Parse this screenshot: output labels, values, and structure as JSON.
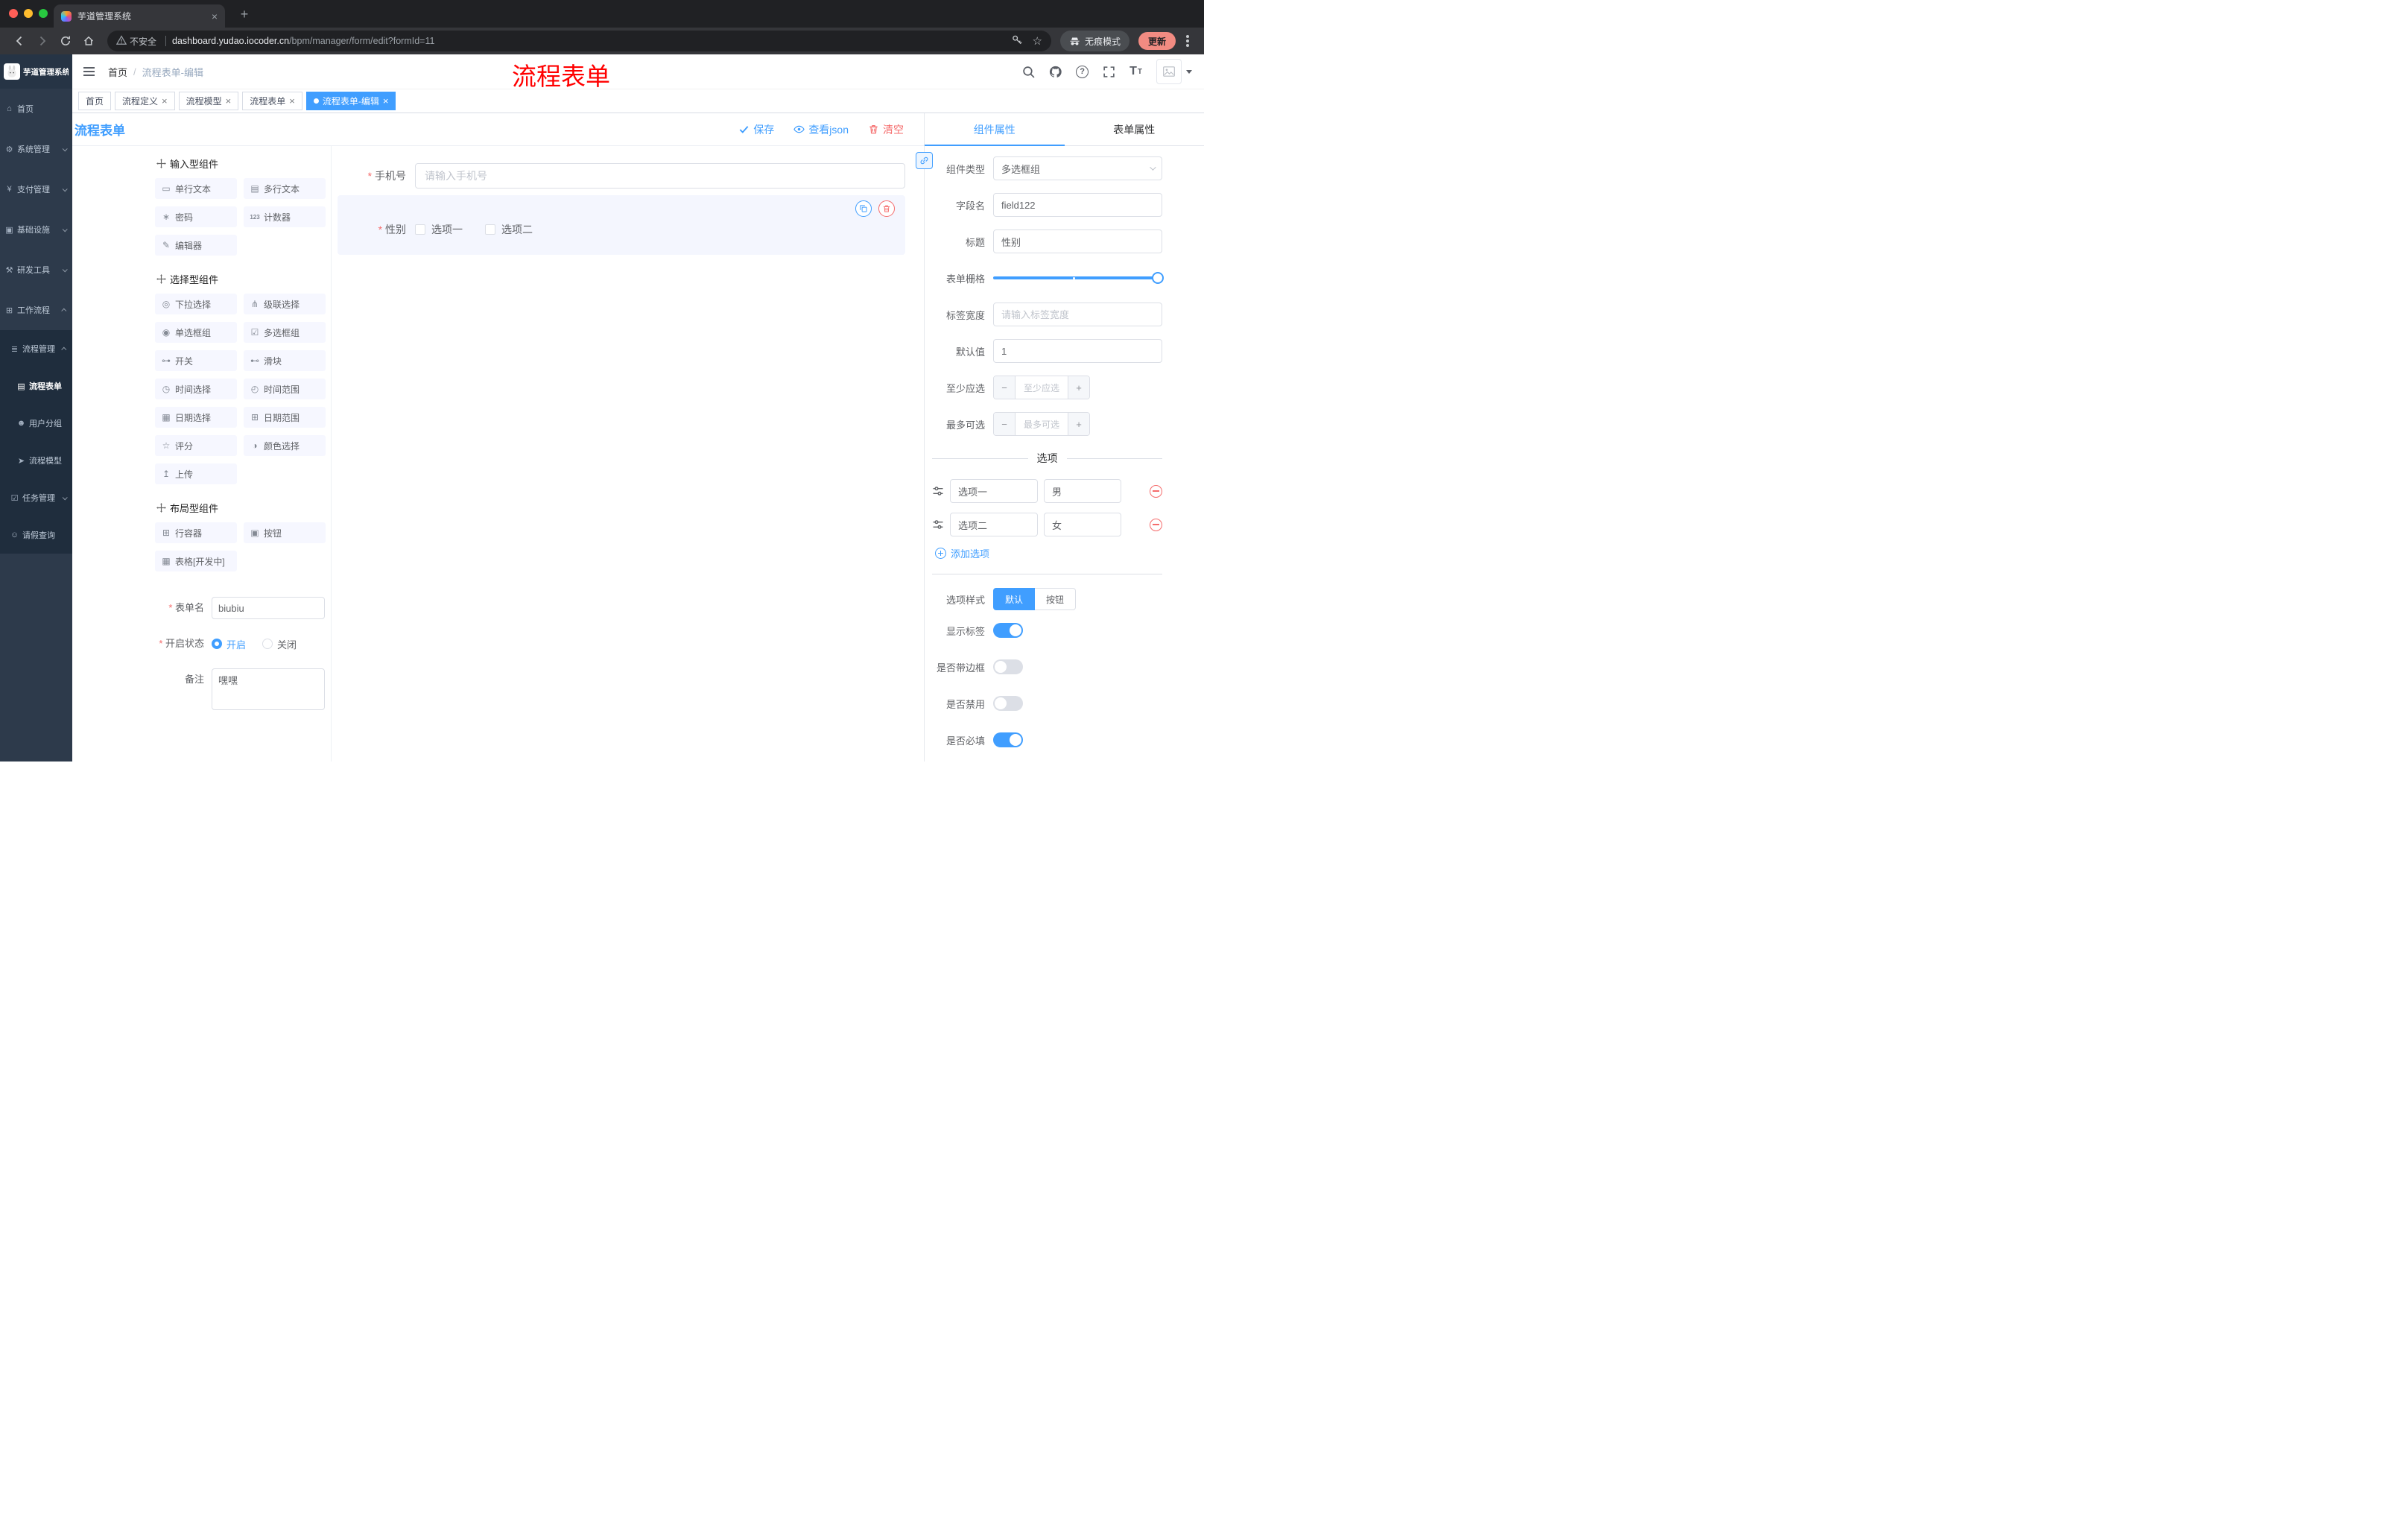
{
  "browser": {
    "tab": {
      "title": "芋道管理系统"
    },
    "address": {
      "security": "不安全",
      "url_domain": "dashboard.yudao.iocoder.cn",
      "url_path": "/bpm/manager/form/edit?formId=11"
    },
    "incognito": "无痕模式",
    "update": "更新"
  },
  "sidebar": {
    "logo": "芋道管理系统",
    "menu": [
      {
        "icon": "⌂",
        "label": "首页"
      },
      {
        "icon": "⚙",
        "label": "系统管理"
      },
      {
        "icon": "¥",
        "label": "支付管理"
      },
      {
        "icon": "▣",
        "label": "基础设施"
      },
      {
        "icon": "⚒",
        "label": "研发工具"
      },
      {
        "icon": "⊞",
        "label": "工作流程"
      },
      {
        "icon": "≣",
        "label": "流程管理"
      },
      {
        "icon": "▤",
        "label": "流程表单"
      },
      {
        "icon": "☻",
        "label": "用户分组"
      },
      {
        "icon": "➤",
        "label": "流程模型"
      },
      {
        "icon": "☑",
        "label": "任务管理"
      },
      {
        "icon": "☺",
        "label": "请假查询"
      }
    ]
  },
  "header": {
    "breadcrumb_home": "首页",
    "breadcrumb_sep": "/",
    "breadcrumb_current": "流程表单-编辑",
    "annotation": "流程表单"
  },
  "tags": {
    "list": [
      "首页",
      "流程定义",
      "流程模型",
      "流程表单",
      "流程表单-编辑"
    ]
  },
  "designer": {
    "title": "流程表单",
    "save": "保存",
    "view_json": "查看json",
    "clear": "清空",
    "palette": {
      "sections": [
        {
          "title": "输入型组件",
          "items": [
            {
              "icon": "▭",
              "label": "单行文本"
            },
            {
              "icon": "▤",
              "label": "多行文本"
            },
            {
              "icon": "∗",
              "label": "密码"
            },
            {
              "icon": "123",
              "label": "计数器"
            },
            {
              "icon": "✎",
              "label": "编辑器"
            }
          ]
        },
        {
          "title": "选择型组件",
          "items": [
            {
              "icon": "◎",
              "label": "下拉选择"
            },
            {
              "icon": "⋔",
              "label": "级联选择"
            },
            {
              "icon": "◉",
              "label": "单选框组"
            },
            {
              "icon": "☑",
              "label": "多选框组"
            },
            {
              "icon": "⊶",
              "label": "开关"
            },
            {
              "icon": "⊷",
              "label": "滑块"
            },
            {
              "icon": "◷",
              "label": "时间选择"
            },
            {
              "icon": "◴",
              "label": "时间范围"
            },
            {
              "icon": "▦",
              "label": "日期选择"
            },
            {
              "icon": "⊞",
              "label": "日期范围"
            },
            {
              "icon": "☆",
              "label": "评分"
            },
            {
              "icon": "◑",
              "label": "颜色选择"
            },
            {
              "icon": "↥",
              "label": "上传"
            }
          ]
        },
        {
          "title": "布局型组件",
          "items": [
            {
              "icon": "⊞",
              "label": "行容器"
            },
            {
              "icon": "▣",
              "label": "按钮"
            },
            {
              "icon": "▦",
              "label": "表格[开发中]"
            }
          ]
        }
      ]
    },
    "config": {
      "name_label": "表单名",
      "name_value": "biubiu",
      "status_label": "开启状态",
      "status_on": "开启",
      "status_off": "关闭",
      "remark_label": "备注",
      "remark_value": "嘿嘿"
    },
    "canvas": {
      "phone_label": "手机号",
      "phone_placeholder": "请输入手机号",
      "gender_label": "性别",
      "gender_opt1": "选项一",
      "gender_opt2": "选项二"
    },
    "props": {
      "tab_component": "组件属性",
      "tab_form": "表单属性",
      "type_label": "组件类型",
      "type_value": "多选框组",
      "field_label": "字段名",
      "field_value": "field122",
      "title_label": "标题",
      "title_value": "性别",
      "grid_label": "表单栅格",
      "width_label": "标签宽度",
      "width_placeholder": "请输入标签宽度",
      "default_label": "默认值",
      "default_value": "1",
      "min_label": "至少应选",
      "min_placeholder": "至少应选",
      "max_label": "最多可选",
      "max_placeholder": "最多可选",
      "stepper_minus": "−",
      "stepper_plus": "+",
      "divider": "选项",
      "options": [
        {
          "label": "选项一",
          "value": "男"
        },
        {
          "label": "选项二",
          "value": "女"
        }
      ],
      "add_option": "添加选项",
      "style_label": "选项样式",
      "style_default": "默认",
      "style_button": "按钮",
      "switch_show_label": "显示标签",
      "switch_border": "是否带边框",
      "switch_disabled": "是否禁用",
      "switch_required": "是否必填"
    }
  },
  "colors": {
    "primary": "#409eff",
    "danger": "#f56c6c"
  }
}
